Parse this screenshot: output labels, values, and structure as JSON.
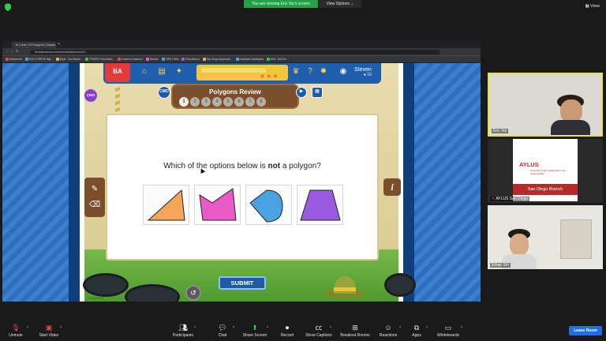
{
  "zoom_top": {
    "viewing_banner": "You are viewing Eric Xie's screen",
    "view_options": "View Options",
    "view_label": "View"
  },
  "browser": {
    "tab_title": "M | Level 3-5 Polygons | Shapes",
    "url": "beastacademy.com/school/play/course/3/…",
    "bookmarks": [
      "Dashboard",
      "2023 TORPOS regi...",
      "tinybi - Tsui Weekl...",
      "TPMSPO Submissio...",
      "Common Hostels #",
      "Rancho",
      "FIRST Web",
      "Recruitment",
      "San Diego Supercom...",
      "Hardware Dashboard",
      "Web - Bot Ton"
    ]
  },
  "game": {
    "logo": "BA",
    "player_name": "Steven",
    "coins": "10",
    "cmo_badge": "CMO",
    "side_badge": "CMO",
    "review_title": "Polygons Review",
    "steps": [
      "1",
      "2",
      "3",
      "4",
      "5",
      "6",
      "7",
      "8"
    ],
    "question_pre": "Which of the options below is ",
    "question_bold": "not",
    "question_post": " a polygon?",
    "options": [
      {
        "shape": "triangle",
        "color": "#f4a55a"
      },
      {
        "shape": "pentagon",
        "color": "#e85bc7"
      },
      {
        "shape": "teardrop",
        "color": "#4aa3e0"
      },
      {
        "shape": "trapezoid",
        "color": "#9a5be0"
      }
    ],
    "submit_label": "SUBMIT",
    "info_label": "i",
    "copyright": "© 2023 AoPS"
  },
  "participants": [
    {
      "name": "Eric Xie",
      "active": true
    },
    {
      "name": "AYLUS San Diego",
      "card_logo": "AYLUS",
      "card_sub": "American Youth Leadership in the United States",
      "card_bar": "San Diego Branch"
    },
    {
      "name": "Ethan Shi"
    }
  ],
  "toolbar": {
    "unmute": "Unmute",
    "start_video": "Start Video",
    "participants": "Participants",
    "participants_count": "3",
    "chat": "Chat",
    "share_screen": "Share Screen",
    "record": "Record",
    "show_captions": "Show Captions",
    "breakout_rooms": "Breakout Rooms",
    "reactions": "Reactions",
    "apps": "Apps",
    "whiteboards": "Whiteboards",
    "leave_room": "Leave Room"
  },
  "colors": {
    "zoom_green": "#24a148",
    "leave_blue": "#1f6fe3",
    "active_speaker": "#e8e24a",
    "game_blue": "#1e5aa6"
  }
}
